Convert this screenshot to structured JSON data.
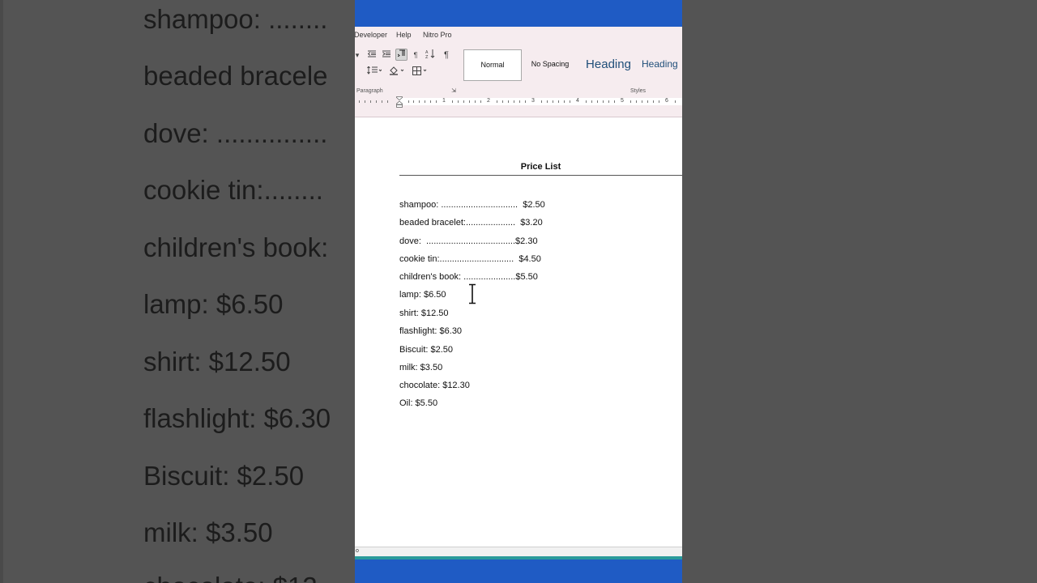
{
  "background_zoom": {
    "lines": [
      "shampoo: ........",
      "beaded bracele",
      "dove:  ...............",
      "cookie tin:........",
      "children's book:",
      "lamp: $6.50",
      "shirt: $12.50",
      "flashlight: $6.30",
      "Biscuit: $2.50",
      "milk: $3.50",
      "chocolate: $12"
    ]
  },
  "menu": {
    "developer": "Developer",
    "help": "Help",
    "nitro": "Nitro Pro"
  },
  "ribbon": {
    "paragraph_label": "Paragraph",
    "styles_label": "Styles",
    "styles": {
      "normal": "Normal",
      "no_spacing": "No Spacing",
      "heading1": "Heading",
      "heading2": "Heading"
    }
  },
  "ruler": {
    "numbers": [
      "1",
      "2",
      "3",
      "4",
      "5",
      "6"
    ]
  },
  "document": {
    "title": "Price List",
    "items": [
      "shampoo: ...............................  $2.50",
      "beaded bracelet:....................  $3.20",
      "dove:  ....................................$2.30",
      "cookie tin:..............................  $4.50",
      "children's book: .....................$5.50",
      "lamp: $6.50",
      "shirt: $12.50",
      "flashlight: $6.30",
      "Biscuit: $2.50",
      "milk: $3.50",
      "chocolate: $12.30",
      "Oil: $5.50"
    ]
  },
  "status": {
    "text": "o"
  },
  "colors": {
    "titlebar": "#1f5bc4",
    "ribbon": "#f6ecef",
    "heading": "#1f4e79"
  }
}
